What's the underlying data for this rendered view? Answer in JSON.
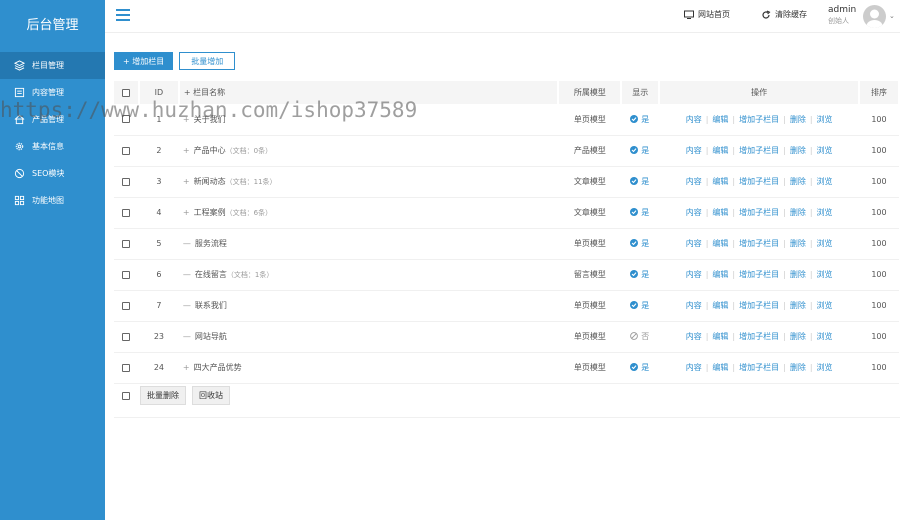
{
  "sidebar": {
    "brand": "后台管理",
    "items": [
      {
        "label": "栏目管理",
        "icon": "layers-icon",
        "active": true
      },
      {
        "label": "内容管理",
        "icon": "document-icon"
      },
      {
        "label": "产品管理",
        "icon": "home-icon"
      },
      {
        "label": "基本信息",
        "icon": "gear-icon"
      },
      {
        "label": "SEO模块",
        "icon": "block-icon"
      },
      {
        "label": "功能地图",
        "icon": "grid-icon"
      }
    ]
  },
  "topbar": {
    "site_home": "网站首页",
    "clear_cache": "清除缓存",
    "user_name": "admin",
    "user_role": "创始人"
  },
  "toolbar": {
    "add_label": "+ 增加栏目",
    "batch_add_label": "批量增加"
  },
  "table": {
    "headers": {
      "id": "ID",
      "name": "+ 栏目名称",
      "model": "所属模型",
      "show": "显示",
      "ops": "操作",
      "sort": "排序"
    },
    "rows": [
      {
        "id": "1",
        "prefix": "+",
        "name": "关于我们",
        "extra": "",
        "model": "单页模型",
        "show": "是",
        "visible": true,
        "sort": "100"
      },
      {
        "id": "2",
        "prefix": "+",
        "name": "产品中心",
        "extra": "（文档：0条）",
        "model": "产品模型",
        "show": "是",
        "visible": true,
        "sort": "100"
      },
      {
        "id": "3",
        "prefix": "+",
        "name": "新闻动态",
        "extra": "（文档：11条）",
        "model": "文章模型",
        "show": "是",
        "visible": true,
        "sort": "100"
      },
      {
        "id": "4",
        "prefix": "+",
        "name": "工程案例",
        "extra": "（文档：6条）",
        "model": "文章模型",
        "show": "是",
        "visible": true,
        "sort": "100"
      },
      {
        "id": "5",
        "prefix": "—",
        "name": "服务流程",
        "extra": "",
        "model": "单页模型",
        "show": "是",
        "visible": true,
        "sort": "100"
      },
      {
        "id": "6",
        "prefix": "—",
        "name": "在线留言",
        "extra": "（文档：1条）",
        "model": "留言模型",
        "show": "是",
        "visible": true,
        "sort": "100"
      },
      {
        "id": "7",
        "prefix": "—",
        "name": "联系我们",
        "extra": "",
        "model": "单页模型",
        "show": "是",
        "visible": true,
        "sort": "100"
      },
      {
        "id": "23",
        "prefix": "—",
        "name": "网站导航",
        "extra": "",
        "model": "单页模型",
        "show": "否",
        "visible": false,
        "sort": "100"
      },
      {
        "id": "24",
        "prefix": "+",
        "name": "四大产品优势",
        "extra": "",
        "model": "单页模型",
        "show": "是",
        "visible": true,
        "sort": "100"
      }
    ],
    "ops": [
      "内容",
      "编辑",
      "增加子栏目",
      "删除",
      "浏览"
    ]
  },
  "footer": {
    "batch_delete": "批量删除",
    "recycle": "回收站"
  },
  "watermark": "https://www.huzhan.com/ishop37589"
}
